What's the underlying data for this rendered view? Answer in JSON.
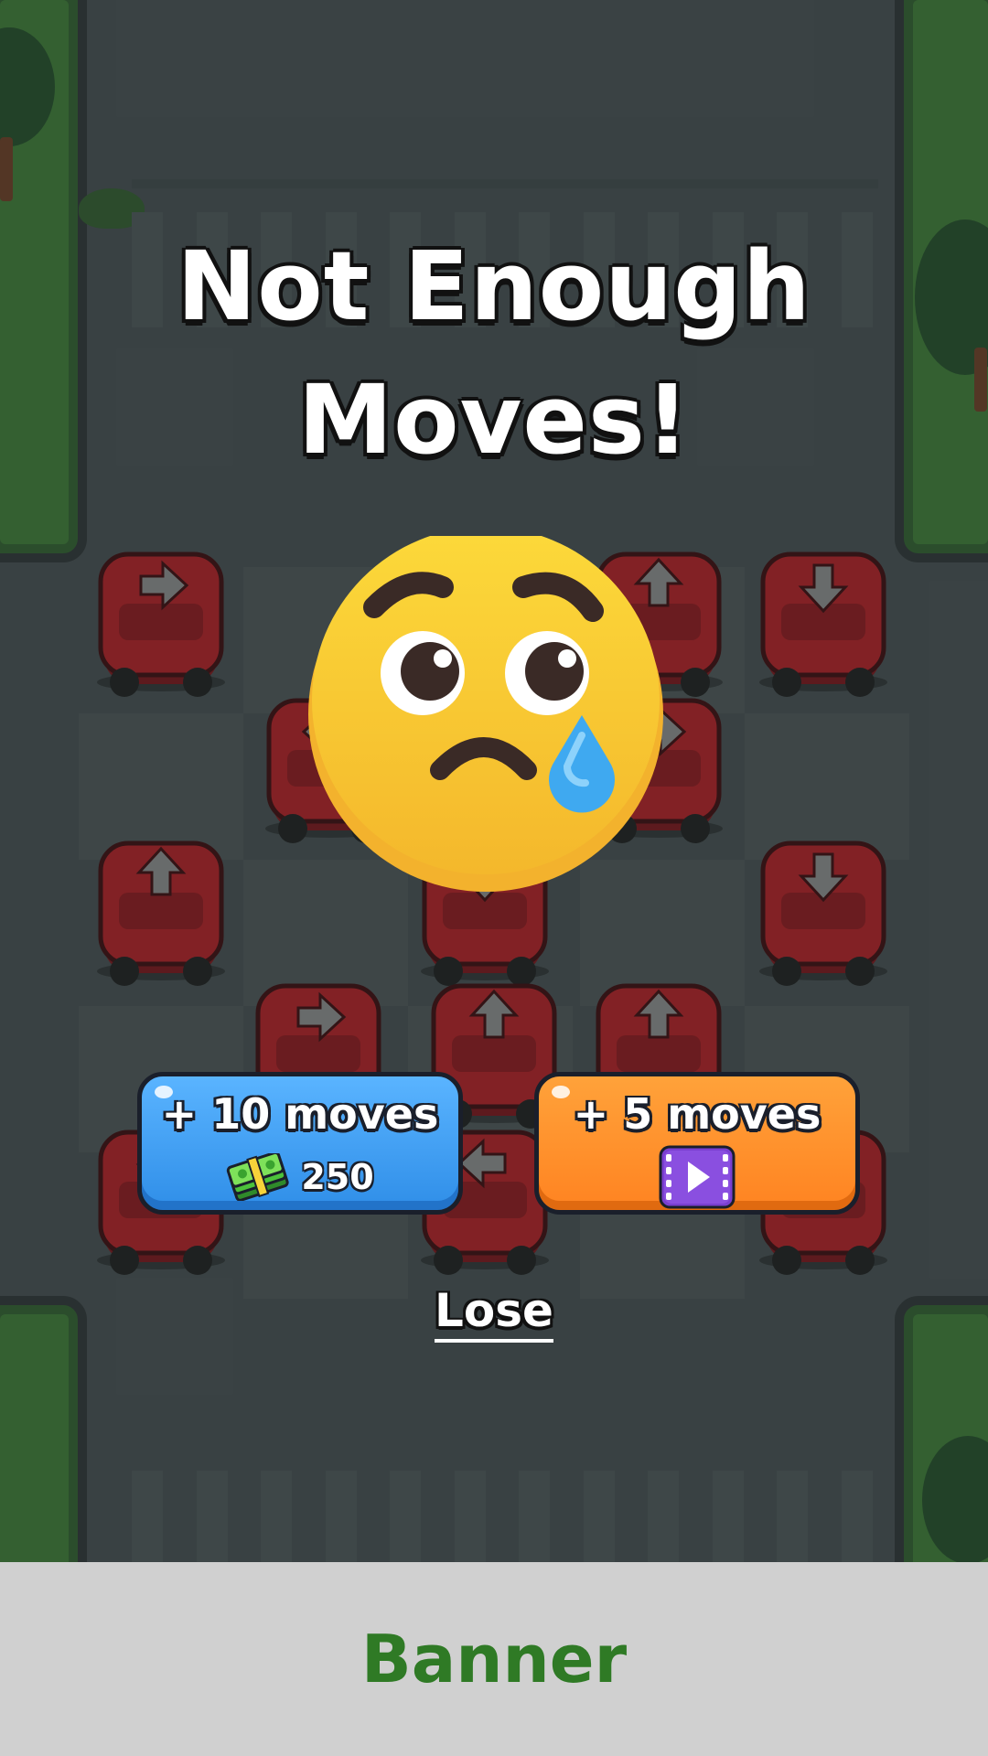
{
  "popup": {
    "title_line1": "Not Enough",
    "title_line2": "Moves!",
    "buy_button": {
      "label": "+ 10 moves",
      "price": "250",
      "icon": "cash-stack-icon"
    },
    "ad_button": {
      "label": "+ 5 moves",
      "icon": "video-play-icon"
    },
    "lose_label": "Lose"
  },
  "banner": {
    "label": "Banner"
  },
  "board": {
    "car_color": "#b2191f",
    "cars": [
      {
        "dir": "right"
      },
      {
        "dir": "up"
      },
      {
        "dir": "down"
      },
      {
        "dir": "left"
      },
      {
        "dir": "right"
      },
      {
        "dir": "up"
      },
      {
        "dir": "down"
      },
      {
        "dir": "down"
      },
      {
        "dir": "right"
      },
      {
        "dir": "up"
      },
      {
        "dir": "up"
      },
      {
        "dir": "down"
      },
      {
        "dir": "left"
      },
      {
        "dir": "up"
      }
    ]
  },
  "colors": {
    "blue_button": "#3d9cf2",
    "orange_button": "#ff8a25",
    "title_text": "#ffffff",
    "banner_text": "#2f7a25"
  }
}
